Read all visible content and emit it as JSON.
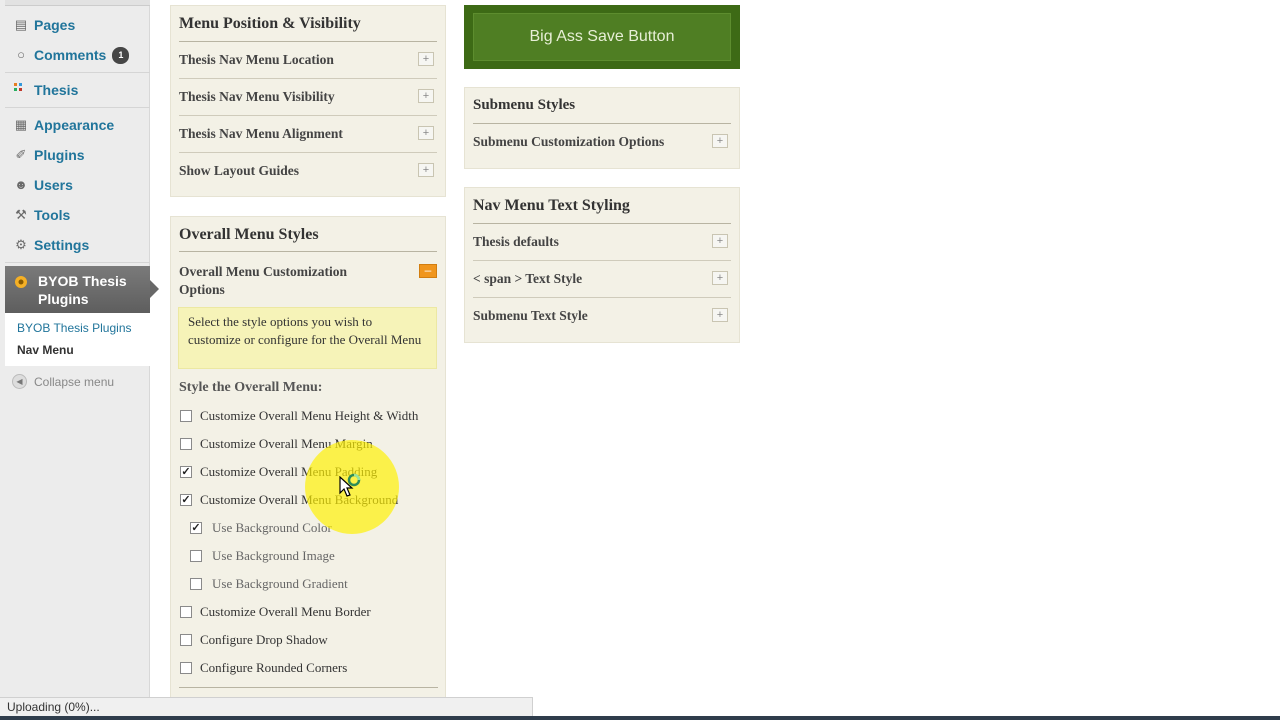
{
  "sidebar": {
    "items": [
      {
        "label": "Pages",
        "icon": "pages-icon"
      },
      {
        "label": "Comments",
        "icon": "comments-icon",
        "badge": "1"
      },
      {
        "label": "Thesis",
        "icon": "thesis-icon"
      },
      {
        "label": "Appearance",
        "icon": "appearance-icon"
      },
      {
        "label": "Plugins",
        "icon": "plugins-icon"
      },
      {
        "label": "Users",
        "icon": "users-icon"
      },
      {
        "label": "Tools",
        "icon": "tools-icon"
      },
      {
        "label": "Settings",
        "icon": "settings-icon"
      }
    ],
    "active": {
      "label": "BYOB Thesis Plugins",
      "icon": "byob-plugin-icon"
    },
    "submenu": [
      "BYOB Thesis Plugins",
      "Nav Menu"
    ],
    "collapse_label": "Collapse menu"
  },
  "position_panel": {
    "title": "Menu Position & Visibility",
    "options": [
      "Thesis Nav Menu Location",
      "Thesis Nav Menu Visibility",
      "Thesis Nav Menu Alignment",
      "Show Layout Guides"
    ]
  },
  "overall_panel": {
    "title": "Overall Menu Styles",
    "section_label": "Overall Menu Customization Options",
    "info_text": "Select the style options you wish to customize or configure for the Overall Menu",
    "style_label": "Style the Overall Menu:",
    "checkboxes": [
      {
        "label": "Customize Overall Menu Height & Width",
        "checked": false
      },
      {
        "label": "Customize Overall Menu Margin",
        "checked": false
      },
      {
        "label": "Customize Overall Menu Padding",
        "checked": true
      },
      {
        "label": "Customize Overall Menu Background",
        "checked": true
      },
      {
        "label": "Use Background Color",
        "checked": true
      },
      {
        "label": "Use Background Image",
        "checked": false
      },
      {
        "label": "Use Background Gradient",
        "checked": false
      },
      {
        "label": "Customize Overall Menu Border",
        "checked": false
      },
      {
        "label": "Configure Drop Shadow",
        "checked": false
      },
      {
        "label": "Configure Rounded Corners",
        "checked": false
      }
    ]
  },
  "save_button": {
    "label": "Big Ass Save Button"
  },
  "submenu_panel": {
    "title": "Submenu Styles",
    "options": [
      "Submenu Customization Options"
    ]
  },
  "text_panel": {
    "title": "Nav Menu Text Styling",
    "options": [
      "Thesis defaults",
      "< span > Text Style",
      "Submenu Text Style"
    ]
  },
  "status": {
    "text": "Uploading (0%)..."
  },
  "colors": {
    "accent_link": "#21759b",
    "save_green": "#4f7e23",
    "expand_orange": "#f0961e",
    "panel_bg": "#f3f1e6"
  }
}
